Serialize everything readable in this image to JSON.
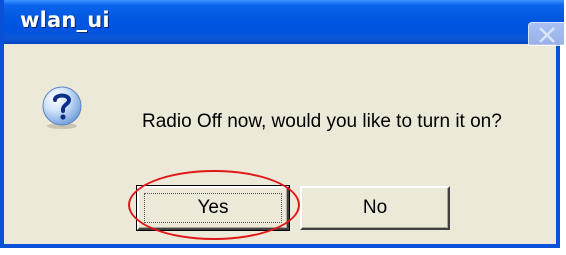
{
  "dialog": {
    "title": "wlan_ui",
    "message": "Radio Off now, would you like to turn it on?",
    "icon": "question-icon",
    "buttons": {
      "yes_label": "Yes",
      "no_label": "No"
    },
    "close_icon": "close-icon"
  },
  "annotation": {
    "shape": "ellipse",
    "target": "yes-button",
    "color": "#e01818"
  },
  "colors": {
    "titlebar": "#0054e3",
    "dialog_background": "#ece9d8",
    "annotation": "#e01818"
  }
}
